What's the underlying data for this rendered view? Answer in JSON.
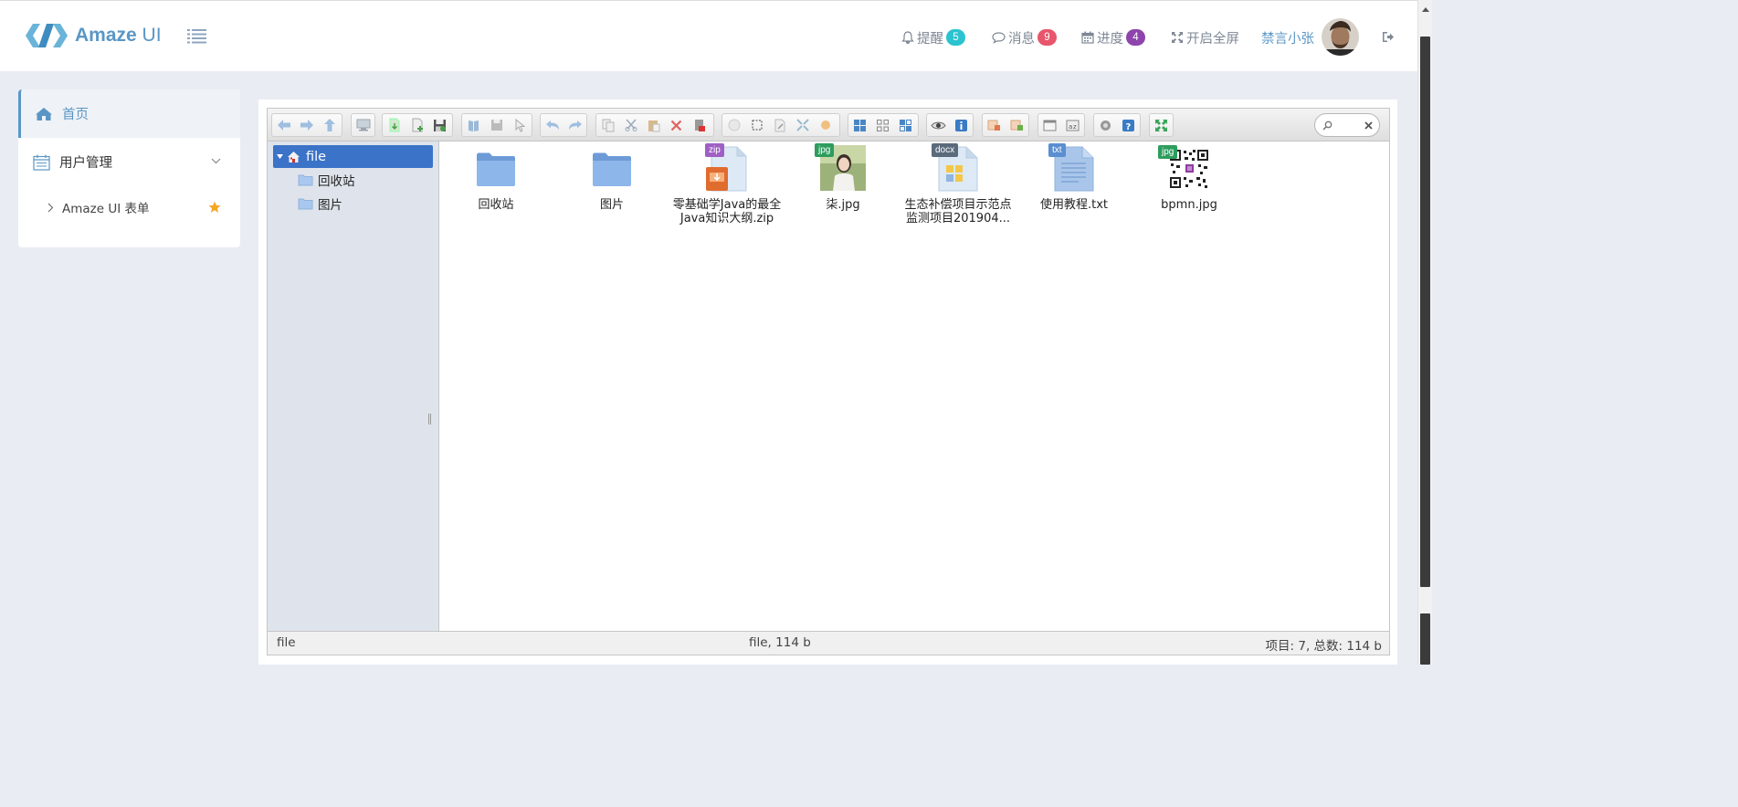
{
  "brand": {
    "name": "Amaze",
    "suffix": "UI"
  },
  "topnav": {
    "reminders": {
      "label": "提醒",
      "count": "5",
      "color": "#2bc3cf"
    },
    "messages": {
      "label": "消息",
      "count": "9",
      "color": "#e7566b"
    },
    "progress": {
      "label": "进度",
      "count": "4",
      "color": "#8e44ad"
    },
    "fullscreen": {
      "label": "开启全屏"
    },
    "user": {
      "name": "禁言小张"
    }
  },
  "sidebar": {
    "items": [
      {
        "label": "首页",
        "icon": "home-icon"
      },
      {
        "label": "用户管理",
        "icon": "calendar-icon"
      }
    ],
    "subitems": [
      {
        "label": "Amaze UI 表单",
        "icon": "star-icon"
      }
    ]
  },
  "filemanager": {
    "tree": {
      "root": "file",
      "children": [
        "回收站",
        "图片"
      ]
    },
    "files": [
      {
        "name": "回收站",
        "kind": "folder"
      },
      {
        "name": "图片",
        "kind": "folder"
      },
      {
        "name": "零基础学Java的最全Java知识大纲.zip",
        "kind": "zip",
        "tag": "zip"
      },
      {
        "name": "柒.jpg",
        "kind": "photo",
        "tag": "jpg"
      },
      {
        "name": "生态补偿项目示范点监测项目201904...",
        "kind": "docx",
        "tag": "docx"
      },
      {
        "name": "使用教程.txt",
        "kind": "txt",
        "tag": "txt"
      },
      {
        "name": "bpmn.jpg",
        "kind": "qr",
        "tag": "jpg"
      }
    ],
    "status": {
      "path": "file",
      "selection": "file, 114 b",
      "summary": "项目: 7, 总数: 114 b"
    }
  },
  "colors": {
    "accent": "#5a96c5",
    "tree_selected": "#3b73c8",
    "page_bg": "#e9ecf3"
  }
}
